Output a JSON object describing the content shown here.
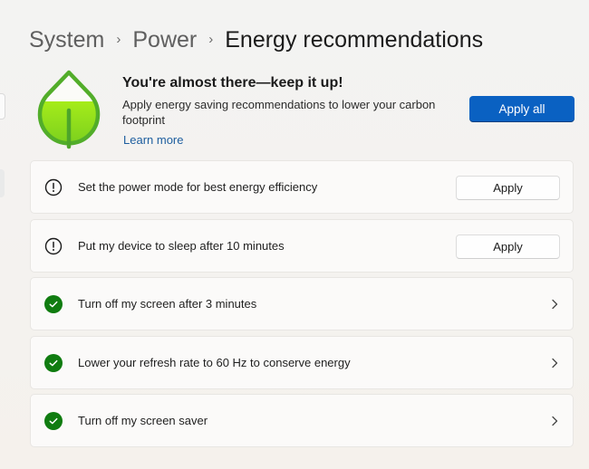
{
  "breadcrumb": {
    "items": [
      "System",
      "Power",
      "Energy recommendations"
    ],
    "separator": "›"
  },
  "hero": {
    "icon": "leaf-icon",
    "title": "You're almost there—keep it up!",
    "description": "Apply energy saving recommendations to lower your carbon footprint",
    "link": "Learn more",
    "apply_all_label": "Apply all"
  },
  "colors": {
    "accent": "#0a61c2",
    "link": "#1d5d9e",
    "success": "#107c10",
    "leaf_outline": "#4fa82a",
    "leaf_fill": "#8fdc1c"
  },
  "recommendations": [
    {
      "label": "Set the power mode for best energy efficiency",
      "status": "pending",
      "icon": "warning-circle-icon",
      "action": "Apply"
    },
    {
      "label": "Put my device to sleep after 10 minutes",
      "status": "pending",
      "icon": "warning-circle-icon",
      "action": "Apply"
    },
    {
      "label": "Turn off my screen after 3 minutes",
      "status": "applied",
      "icon": "checkmark-circle-icon",
      "action": "chevron-right-icon"
    },
    {
      "label": "Lower your refresh rate to 60 Hz to conserve energy",
      "status": "applied",
      "icon": "checkmark-circle-icon",
      "action": "chevron-right-icon"
    },
    {
      "label": "Turn off my screen saver",
      "status": "applied",
      "icon": "checkmark-circle-icon",
      "action": "chevron-right-icon"
    }
  ]
}
